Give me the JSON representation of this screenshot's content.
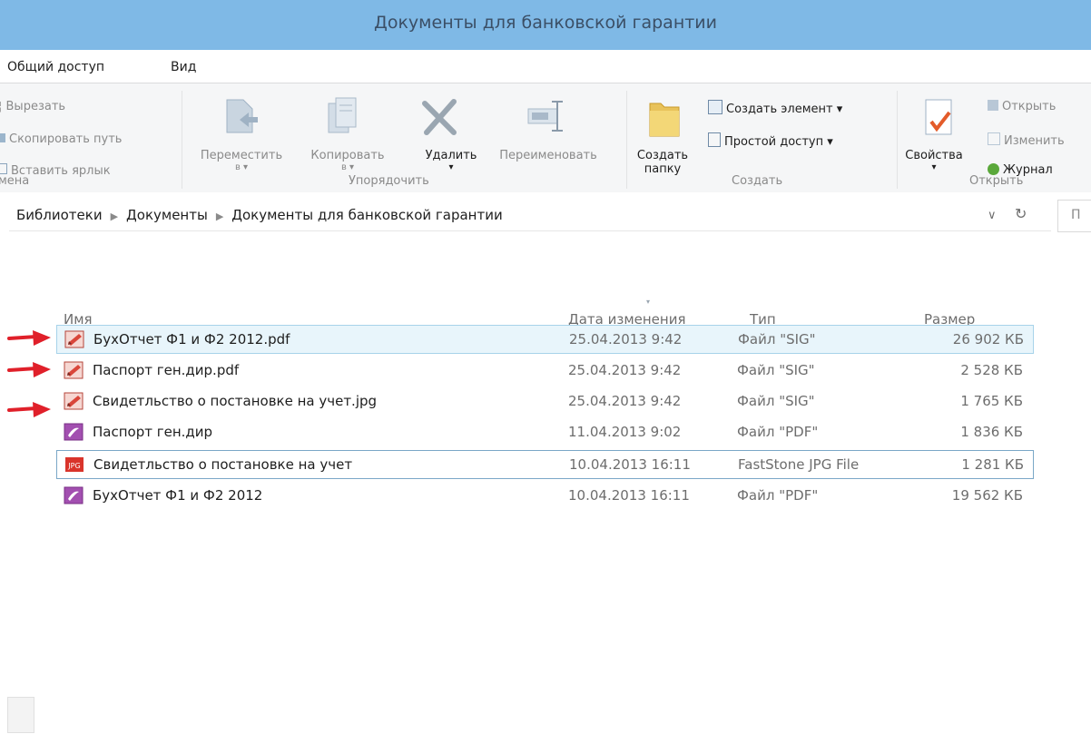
{
  "window": {
    "title": "Документы для банковской гарантии"
  },
  "menubar": {
    "items": [
      "Общий доступ",
      "Вид"
    ]
  },
  "ribbon": {
    "clipboard": {
      "cut": "Вырезать",
      "copy_path": "Скопировать путь",
      "paste_shortcut": "Вставить ярлык",
      "group_label": "мена"
    },
    "organize": {
      "move_label": "Переместить",
      "move_sub": "в ▾",
      "copy_label": "Копировать",
      "copy_sub": "в ▾",
      "delete_label": "Удалить",
      "delete_sub": "▾",
      "rename_label": "Переименовать",
      "group_label": "Упорядочить"
    },
    "create": {
      "new_folder_label_1": "Создать",
      "new_folder_label_2": "папку",
      "new_item": "Создать элемент ▾",
      "easy_access": "Простой доступ ▾",
      "group_label": "Создать"
    },
    "open": {
      "properties_label": "Свойства",
      "properties_sub": "▾",
      "open": "Открыть",
      "edit": "Изменить",
      "history": "Журнал",
      "group_label": "Открыть"
    }
  },
  "address": {
    "breadcrumb": [
      "Библиотеки",
      "Документы",
      "Документы для банковской гарантии"
    ],
    "dropdown_glyph": "∨",
    "refresh_glyph": "↻",
    "search_partial": "П"
  },
  "columns": {
    "name": "Имя",
    "date": "Дата изменения",
    "type": "Тип",
    "size": "Размер"
  },
  "files": [
    {
      "name": "БухОтчет Ф1 и Ф2 2012.pdf",
      "date": "25.04.2013 9:42",
      "type": "Файл \"SIG\"",
      "size": "26 902 КБ",
      "icon": "sig-file-icon",
      "arrow": true,
      "state": "selected"
    },
    {
      "name": "Паспорт ген.дир.pdf",
      "date": "25.04.2013 9:42",
      "type": "Файл \"SIG\"",
      "size": "2 528 КБ",
      "icon": "sig-file-icon",
      "arrow": true,
      "state": ""
    },
    {
      "name": "Свидетльство о постановке на учет.jpg",
      "date": "25.04.2013 9:42",
      "type": "Файл \"SIG\"",
      "size": "1 765 КБ",
      "icon": "sig-file-icon",
      "arrow": true,
      "state": ""
    },
    {
      "name": "Паспорт ген.дир",
      "date": "11.04.2013 9:02",
      "type": "Файл \"PDF\"",
      "size": "1 836 КБ",
      "icon": "pdf-file-icon",
      "arrow": false,
      "state": ""
    },
    {
      "name": "Свидетльство о постановке на учет",
      "date": "10.04.2013 16:11",
      "type": "FastStone JPG File",
      "size": "1 281 КБ",
      "icon": "jpg-file-icon",
      "arrow": false,
      "state": "focus"
    },
    {
      "name": "БухОтчет Ф1 и Ф2 2012",
      "date": "10.04.2013 16:11",
      "type": "Файл \"PDF\"",
      "size": "19 562 КБ",
      "icon": "pdf-file-icon",
      "arrow": false,
      "state": ""
    }
  ],
  "colors": {
    "titlebar": "#7fb9e6",
    "arrow": "#e0202a",
    "selection": "#e8f5fb"
  }
}
